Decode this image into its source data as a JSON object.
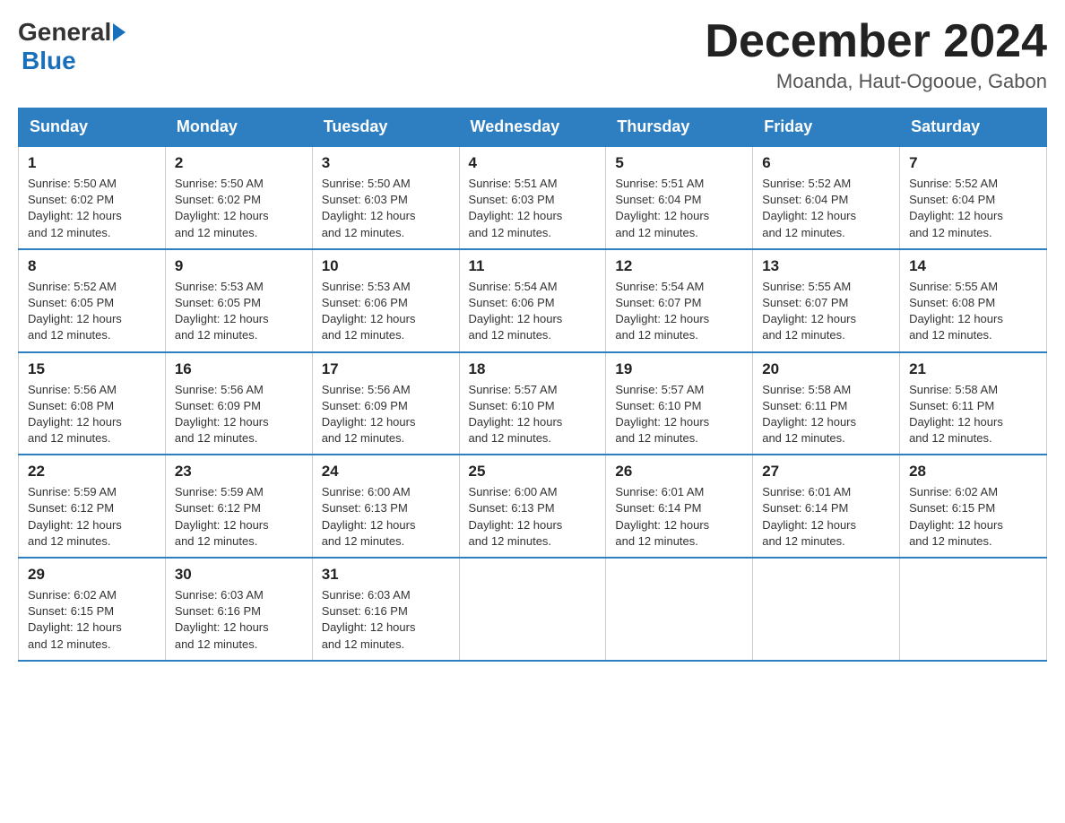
{
  "header": {
    "logo": {
      "general": "General",
      "blue": "Blue"
    },
    "title": "December 2024",
    "location": "Moanda, Haut-Ogooue, Gabon"
  },
  "days_of_week": [
    "Sunday",
    "Monday",
    "Tuesday",
    "Wednesday",
    "Thursday",
    "Friday",
    "Saturday"
  ],
  "weeks": [
    [
      {
        "day": "1",
        "sunrise": "5:50 AM",
        "sunset": "6:02 PM",
        "daylight": "12 hours and 12 minutes."
      },
      {
        "day": "2",
        "sunrise": "5:50 AM",
        "sunset": "6:02 PM",
        "daylight": "12 hours and 12 minutes."
      },
      {
        "day": "3",
        "sunrise": "5:50 AM",
        "sunset": "6:03 PM",
        "daylight": "12 hours and 12 minutes."
      },
      {
        "day": "4",
        "sunrise": "5:51 AM",
        "sunset": "6:03 PM",
        "daylight": "12 hours and 12 minutes."
      },
      {
        "day": "5",
        "sunrise": "5:51 AM",
        "sunset": "6:04 PM",
        "daylight": "12 hours and 12 minutes."
      },
      {
        "day": "6",
        "sunrise": "5:52 AM",
        "sunset": "6:04 PM",
        "daylight": "12 hours and 12 minutes."
      },
      {
        "day": "7",
        "sunrise": "5:52 AM",
        "sunset": "6:04 PM",
        "daylight": "12 hours and 12 minutes."
      }
    ],
    [
      {
        "day": "8",
        "sunrise": "5:52 AM",
        "sunset": "6:05 PM",
        "daylight": "12 hours and 12 minutes."
      },
      {
        "day": "9",
        "sunrise": "5:53 AM",
        "sunset": "6:05 PM",
        "daylight": "12 hours and 12 minutes."
      },
      {
        "day": "10",
        "sunrise": "5:53 AM",
        "sunset": "6:06 PM",
        "daylight": "12 hours and 12 minutes."
      },
      {
        "day": "11",
        "sunrise": "5:54 AM",
        "sunset": "6:06 PM",
        "daylight": "12 hours and 12 minutes."
      },
      {
        "day": "12",
        "sunrise": "5:54 AM",
        "sunset": "6:07 PM",
        "daylight": "12 hours and 12 minutes."
      },
      {
        "day": "13",
        "sunrise": "5:55 AM",
        "sunset": "6:07 PM",
        "daylight": "12 hours and 12 minutes."
      },
      {
        "day": "14",
        "sunrise": "5:55 AM",
        "sunset": "6:08 PM",
        "daylight": "12 hours and 12 minutes."
      }
    ],
    [
      {
        "day": "15",
        "sunrise": "5:56 AM",
        "sunset": "6:08 PM",
        "daylight": "12 hours and 12 minutes."
      },
      {
        "day": "16",
        "sunrise": "5:56 AM",
        "sunset": "6:09 PM",
        "daylight": "12 hours and 12 minutes."
      },
      {
        "day": "17",
        "sunrise": "5:56 AM",
        "sunset": "6:09 PM",
        "daylight": "12 hours and 12 minutes."
      },
      {
        "day": "18",
        "sunrise": "5:57 AM",
        "sunset": "6:10 PM",
        "daylight": "12 hours and 12 minutes."
      },
      {
        "day": "19",
        "sunrise": "5:57 AM",
        "sunset": "6:10 PM",
        "daylight": "12 hours and 12 minutes."
      },
      {
        "day": "20",
        "sunrise": "5:58 AM",
        "sunset": "6:11 PM",
        "daylight": "12 hours and 12 minutes."
      },
      {
        "day": "21",
        "sunrise": "5:58 AM",
        "sunset": "6:11 PM",
        "daylight": "12 hours and 12 minutes."
      }
    ],
    [
      {
        "day": "22",
        "sunrise": "5:59 AM",
        "sunset": "6:12 PM",
        "daylight": "12 hours and 12 minutes."
      },
      {
        "day": "23",
        "sunrise": "5:59 AM",
        "sunset": "6:12 PM",
        "daylight": "12 hours and 12 minutes."
      },
      {
        "day": "24",
        "sunrise": "6:00 AM",
        "sunset": "6:13 PM",
        "daylight": "12 hours and 12 minutes."
      },
      {
        "day": "25",
        "sunrise": "6:00 AM",
        "sunset": "6:13 PM",
        "daylight": "12 hours and 12 minutes."
      },
      {
        "day": "26",
        "sunrise": "6:01 AM",
        "sunset": "6:14 PM",
        "daylight": "12 hours and 12 minutes."
      },
      {
        "day": "27",
        "sunrise": "6:01 AM",
        "sunset": "6:14 PM",
        "daylight": "12 hours and 12 minutes."
      },
      {
        "day": "28",
        "sunrise": "6:02 AM",
        "sunset": "6:15 PM",
        "daylight": "12 hours and 12 minutes."
      }
    ],
    [
      {
        "day": "29",
        "sunrise": "6:02 AM",
        "sunset": "6:15 PM",
        "daylight": "12 hours and 12 minutes."
      },
      {
        "day": "30",
        "sunrise": "6:03 AM",
        "sunset": "6:16 PM",
        "daylight": "12 hours and 12 minutes."
      },
      {
        "day": "31",
        "sunrise": "6:03 AM",
        "sunset": "6:16 PM",
        "daylight": "12 hours and 12 minutes."
      },
      null,
      null,
      null,
      null
    ]
  ],
  "labels": {
    "sunrise": "Sunrise:",
    "sunset": "Sunset:",
    "daylight": "Daylight:"
  },
  "colors": {
    "header_bg": "#2e7fc1",
    "border": "#2e7fc1"
  }
}
